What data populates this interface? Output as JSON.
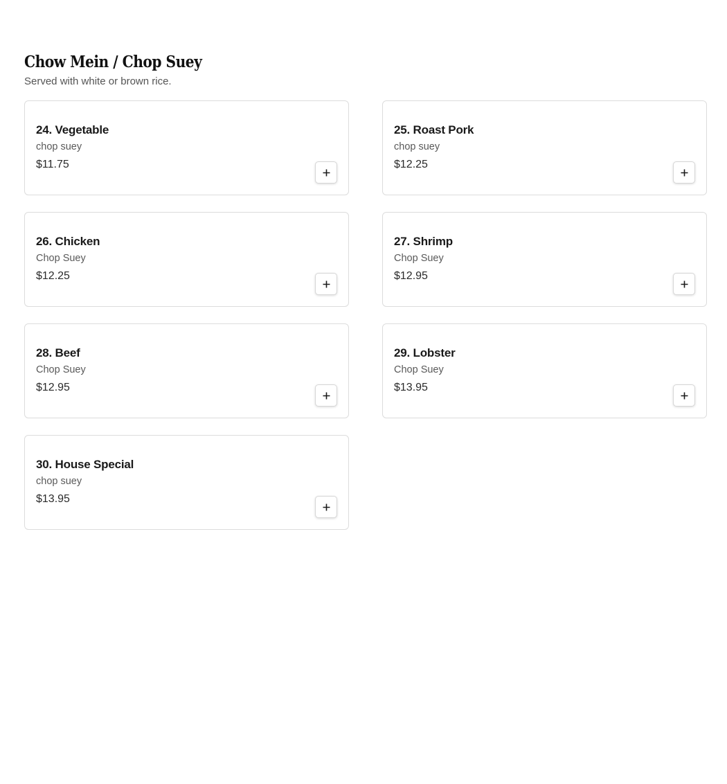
{
  "section": {
    "title": "Chow Mein / Chop Suey",
    "description": "Served with white or brown rice."
  },
  "icons": {
    "add": "plus-icon"
  },
  "colors": {
    "card_border": "#dcdcdc",
    "text_primary": "#191919",
    "text_secondary": "#595959"
  },
  "items": [
    {
      "name": "24. Vegetable",
      "description": "chop suey",
      "price": "$11.75"
    },
    {
      "name": "25. Roast Pork",
      "description": "chop suey",
      "price": "$12.25"
    },
    {
      "name": "26. Chicken",
      "description": "Chop Suey",
      "price": "$12.25"
    },
    {
      "name": "27. Shrimp",
      "description": "Chop Suey",
      "price": "$12.95"
    },
    {
      "name": "28. Beef",
      "description": "Chop Suey",
      "price": "$12.95"
    },
    {
      "name": "29. Lobster",
      "description": "Chop Suey",
      "price": "$13.95"
    },
    {
      "name": "30. House Special",
      "description": "chop suey",
      "price": "$13.95"
    }
  ]
}
